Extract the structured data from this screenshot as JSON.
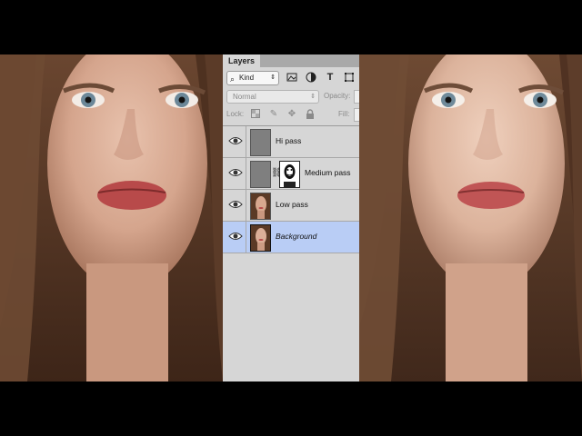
{
  "panel": {
    "tab_label": "Layers",
    "filter": {
      "kind_label": "Kind",
      "icons": [
        "image-filter-icon",
        "adjustment-filter-icon",
        "type-filter-icon",
        "shape-filter-icon"
      ]
    },
    "blend_mode": "Normal",
    "opacity_label": "Opacity:",
    "lock_label": "Lock:",
    "lock_icons": [
      "lock-transparent-icon",
      "lock-paint-icon",
      "lock-position-icon",
      "lock-all-icon"
    ],
    "fill_label": "Fill:",
    "layers": [
      {
        "name": "Hi pass",
        "visible": true,
        "selected": false,
        "thumbnail": "gray-fill",
        "has_mask": false
      },
      {
        "name": "Medium pass",
        "visible": true,
        "selected": false,
        "thumbnail": "gray-fill",
        "has_mask": true
      },
      {
        "name": "Low pass",
        "visible": true,
        "selected": false,
        "thumbnail": "portrait",
        "has_mask": false
      },
      {
        "name": "Background",
        "visible": true,
        "selected": true,
        "thumbnail": "portrait",
        "has_mask": false
      }
    ]
  },
  "colors": {
    "panel_bg": "#d6d6d6",
    "selected_row": "#b9cdf5",
    "letterbox": "#000000"
  }
}
